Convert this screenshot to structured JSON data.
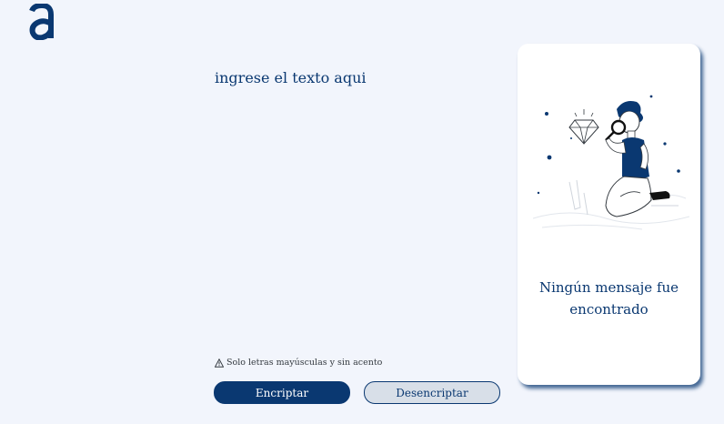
{
  "logo": {
    "letter": "a",
    "color": "#0a3871"
  },
  "input": {
    "placeholder": "ingrese el texto aqui",
    "value": ""
  },
  "hint": {
    "icon": "warning-icon",
    "text": "Solo letras mayúsculas y sin acento"
  },
  "buttons": {
    "encrypt_label": "Encriptar",
    "decrypt_label": "Desencriptar"
  },
  "output_panel": {
    "illustration": "person-with-magnifying-glass-illustration",
    "empty_message": "Ningún mensaje fue encontrado"
  },
  "colors": {
    "background": "#f2f5fc",
    "primary": "#0a3871",
    "secondary_button": "#d8dfe8",
    "panel": "#ffffff"
  }
}
